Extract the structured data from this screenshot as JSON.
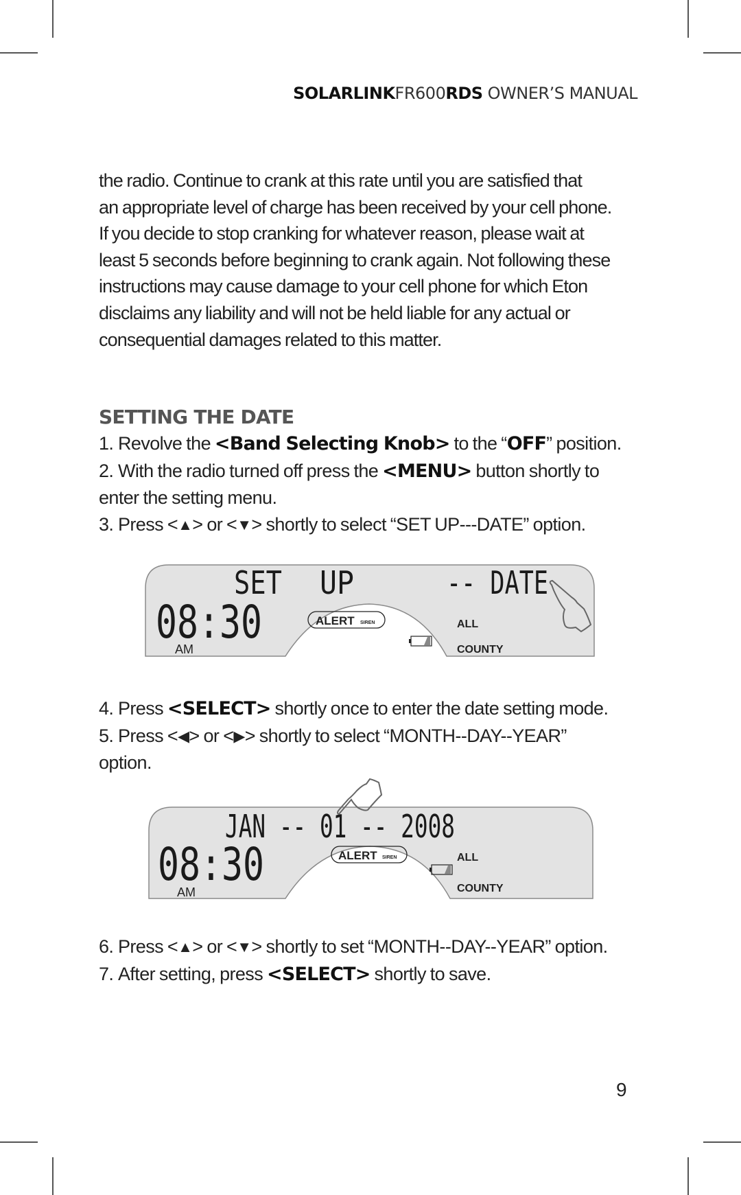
{
  "header": {
    "brand_bold": "SOLARLINK",
    "model": "FR600",
    "model_suffix": "RDS",
    "title": " OWNER’S MANUAL"
  },
  "intro_paragraph": [
    "the radio. Continue to crank at this rate until you are satisfied that",
    "an appropriate level of charge has been received by your cell phone.",
    "If you decide to stop cranking for whatever reason, please wait at",
    "least 5 seconds before beginning to crank again. Not following these",
    "instructions may cause damage to your cell phone for which Eton",
    "disclaims any liability and will not be held liable for any actual or",
    "consequential damages related to this matter."
  ],
  "section": {
    "heading": "SETTING THE DATE",
    "steps": [
      {
        "num": "1.",
        "pre": "Revolve the ",
        "bold": "<Band Selecting Knob>",
        "mid": " to the “",
        "bold2": "OFF",
        "post": "” position."
      },
      {
        "num": "2.",
        "pre": "With the radio turned off press the ",
        "bold": "<MENU>",
        "post": " button shortly to",
        "cont": "enter the setting menu."
      },
      {
        "num": "3.",
        "pre": "Press <",
        "icon1": "▲",
        "mid": "> or <",
        "icon2": "▼",
        "post": "> shortly to select “SET UP---DATE” option."
      },
      {
        "num": "4.",
        "pre": "Press ",
        "bold": "<SELECT>",
        "post": " shortly once to enter the date setting mode."
      },
      {
        "num": "5.",
        "pre": "Press <",
        "icon1": "◀",
        "mid": "> or <",
        "icon2": "▶",
        "post": "> shortly to select “MONTH--DAY--YEAR”",
        "cont": "option."
      },
      {
        "num": "6.",
        "pre": "Press <",
        "icon1": "▲",
        "mid": "> or <",
        "icon2": "▼",
        "post": "> shortly to set “MONTH--DAY--YEAR” option."
      },
      {
        "num": "7.",
        "pre": "After setting, press ",
        "bold": "<SELECT>",
        "post": " shortly to save."
      }
    ]
  },
  "lcd_setup": {
    "line1_a": "SET",
    "line1_b": "UP",
    "line1_c": "-- DATE",
    "time": "08:30",
    "ampm": "AM",
    "alert": "ALERT",
    "siren": "SIREN",
    "all": "ALL",
    "county": "COUNTY",
    "pointer_icon": "hand-pointer-icon"
  },
  "lcd_date": {
    "line1": "JAN -- 01 -- 2008",
    "time": "08:30",
    "ampm": "AM",
    "alert": "ALERT",
    "siren": "SIREN",
    "all": "ALL",
    "county": "COUNTY",
    "pointer_icon": "hand-pointer-icon"
  },
  "page_number": "9",
  "colors": {
    "lcd_background": "#e3e3e3",
    "lcd_border": "#8a8a8a",
    "heading": "#555555",
    "text": "#222222"
  }
}
